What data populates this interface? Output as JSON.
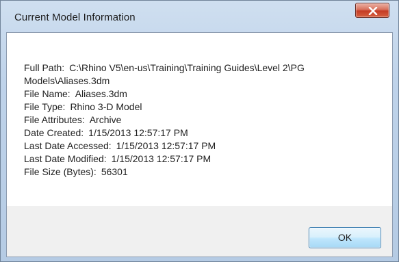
{
  "window": {
    "title": "Current Model Information",
    "close_icon": "close-icon"
  },
  "info": {
    "full_path_label": "Full Path:",
    "full_path_value_line1": "C:\\Rhino V5\\en-us\\Training\\Training Guides\\Level 2\\PG",
    "full_path_value_line2": "Models\\Aliases.3dm",
    "file_name_label": "File Name:",
    "file_name_value": "Aliases.3dm",
    "file_type_label": "File Type:",
    "file_type_value": "Rhino 3-D Model",
    "file_attributes_label": "File Attributes:",
    "file_attributes_value": "Archive",
    "date_created_label": "Date Created:",
    "date_created_value": "1/15/2013 12:57:17 PM",
    "last_accessed_label": "Last Date Accessed:",
    "last_accessed_value": "1/15/2013 12:57:17 PM",
    "last_modified_label": "Last Date Modified:",
    "last_modified_value": "1/15/2013 12:57:17 PM",
    "file_size_label": "File Size (Bytes):",
    "file_size_value": "56301"
  },
  "buttons": {
    "ok_label": "OK"
  }
}
